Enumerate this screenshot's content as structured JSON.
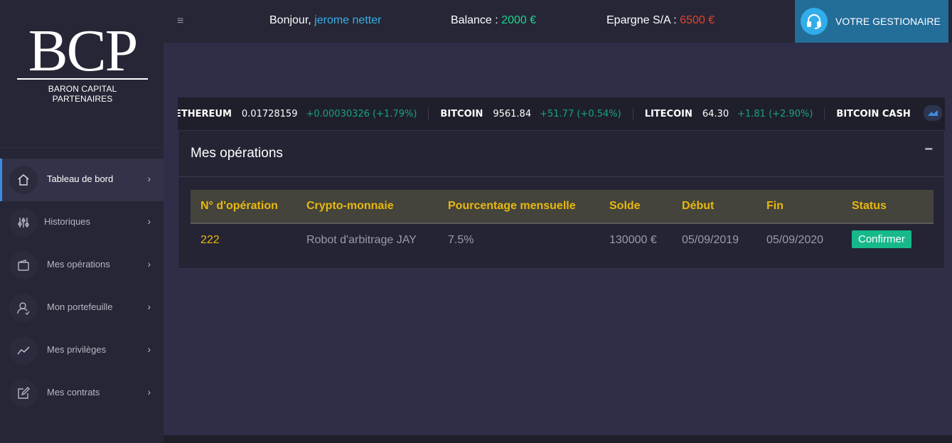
{
  "logo": {
    "letters": "BCP",
    "subtitle": "BARON CAPITAL PARTENAIRES"
  },
  "sidebar": {
    "items": [
      {
        "label": "Tableau de bord",
        "icon": "home-icon",
        "active": true
      },
      {
        "label": "Historiques",
        "icon": "sliders-icon",
        "active": false
      },
      {
        "label": "Mes opérations",
        "icon": "wallet-icon",
        "active": false
      },
      {
        "label": "Mon portefeuille",
        "icon": "user-icon",
        "active": false
      },
      {
        "label": "Mes privilèges",
        "icon": "trend-icon",
        "active": false
      },
      {
        "label": "Mes contrats",
        "icon": "edit-icon",
        "active": false
      }
    ],
    "chevron": "›"
  },
  "topbar": {
    "menu_icon": "≡",
    "greeting": "Bonjour,",
    "user_name": "jerome netter",
    "balance_label": "Balance :",
    "balance_value": "2000 €",
    "epargne_label": "Epargne S/A :",
    "epargne_value": "6500 €",
    "gestionnaire_label": "VOTRE GESTIONAIRE"
  },
  "ticker": {
    "items": [
      {
        "name": "ETHEREUM",
        "price": "0.01728159",
        "change": "+0.00030326 (+1.79%)"
      },
      {
        "name": "BITCOIN",
        "price": "9561.84",
        "change": "+51.77 (+0.54%)"
      },
      {
        "name": "LITECOIN",
        "price": "64.30",
        "change": "+1.81 (+2.90%)"
      },
      {
        "name": "BITCOIN CASH",
        "price": "",
        "change": ""
      }
    ]
  },
  "panel": {
    "title": "Mes opérations",
    "collapse_icon": "−"
  },
  "table": {
    "headers": [
      "N° d'opération",
      "Crypto-monnaie",
      "Pourcentage mensuelle",
      "Solde",
      "Début",
      "Fin",
      "Status"
    ],
    "rows": [
      {
        "id": "222",
        "crypto": "Robot d'arbitrage JAY",
        "percent": "7.5%",
        "solde": "130000 €",
        "debut": "05/09/2019",
        "fin": "05/09/2020",
        "status": "Confirmer"
      }
    ]
  },
  "colors": {
    "accent_blue": "#3bb0e6",
    "balance_green": "#1ed48c",
    "epargne_red": "#e4422c",
    "header_gold": "#e9b80e",
    "status_green": "#17b88a"
  }
}
